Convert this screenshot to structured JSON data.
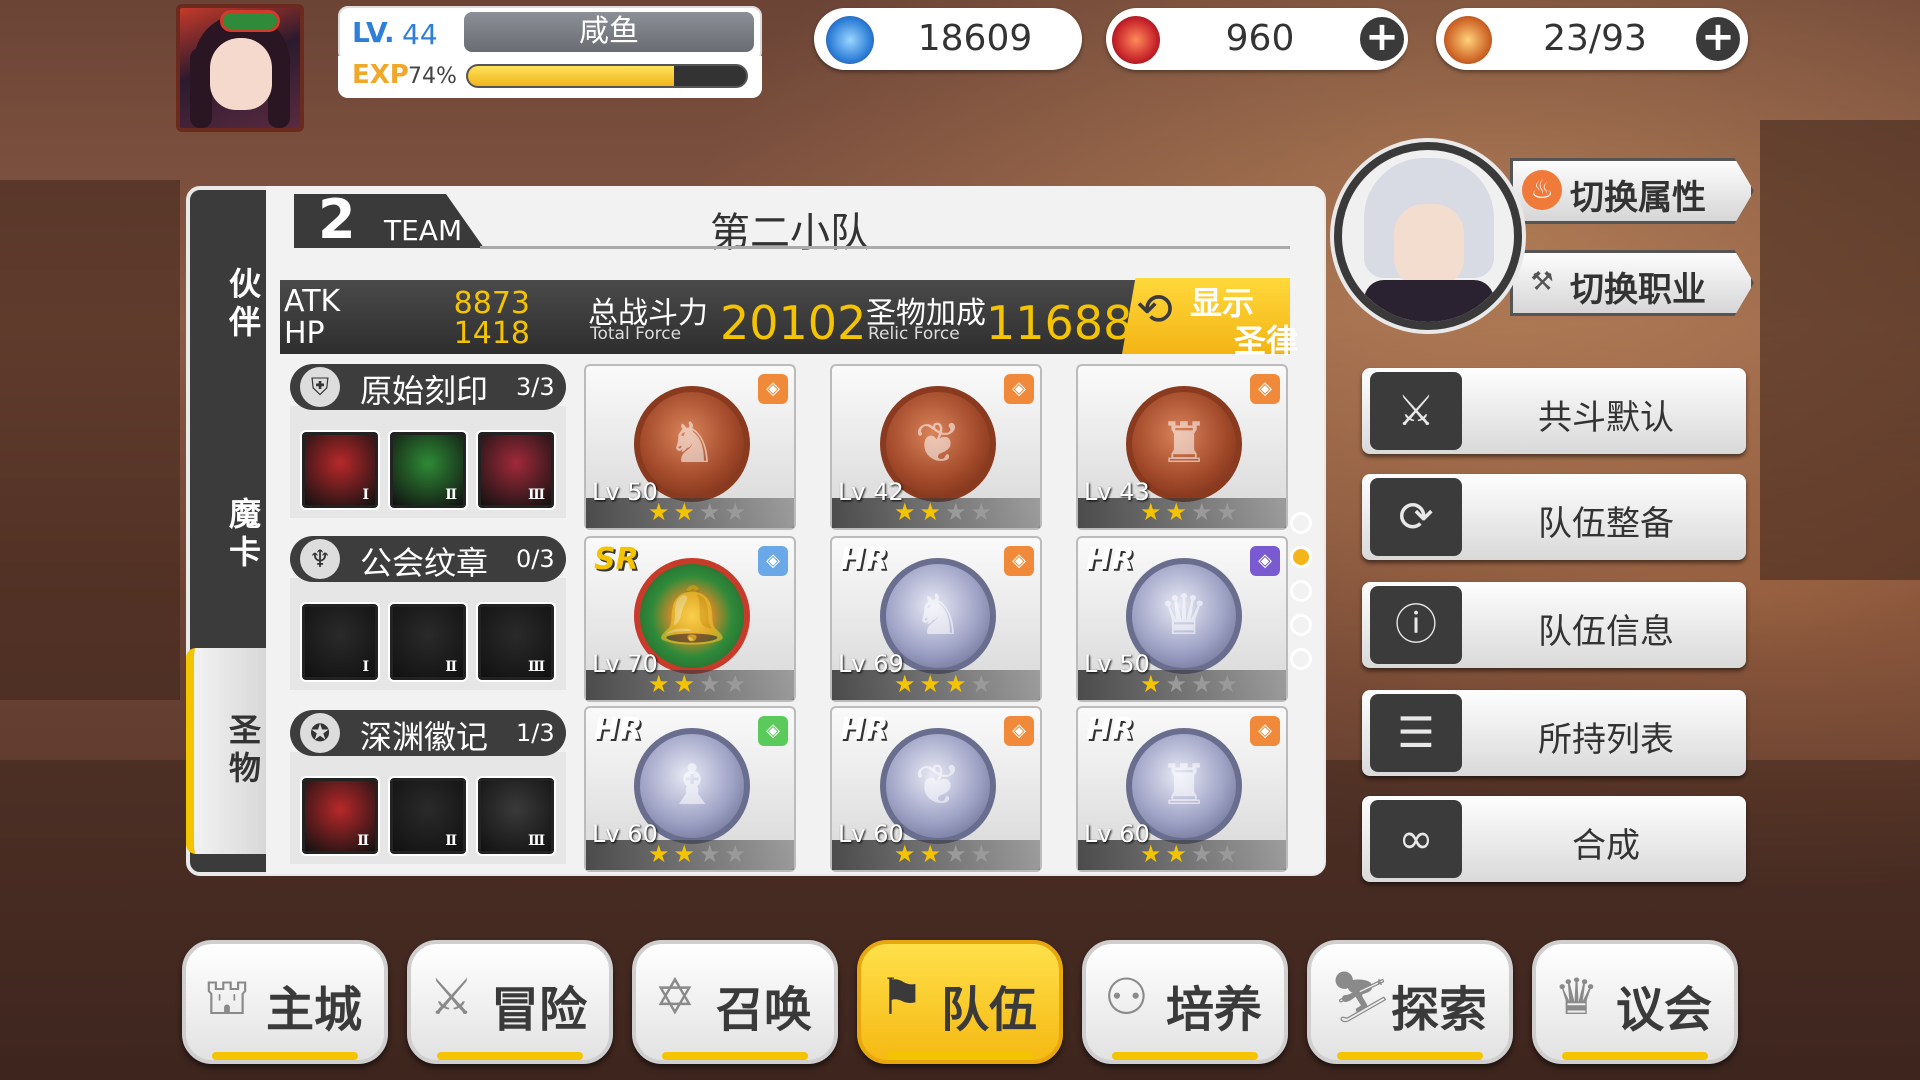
{
  "player": {
    "lv_label": "LV.",
    "level": "44",
    "name": "咸鱼",
    "exp_label": "EXP",
    "exp_percent_text": "74%",
    "exp_fraction": 0.74
  },
  "resources": [
    {
      "icon": "blue-flame-icon",
      "value": "18609",
      "has_plus": false
    },
    {
      "icon": "ruby-crystal-icon",
      "value": "960",
      "has_plus": true
    },
    {
      "icon": "hotdog-stamina-icon",
      "value": "23/93",
      "has_plus": true
    }
  ],
  "side_tabs": [
    {
      "label": "伙伴",
      "active": false
    },
    {
      "label": "魔卡",
      "active": false
    },
    {
      "label": "圣物",
      "active": true
    }
  ],
  "team": {
    "number": "2",
    "team_label": "TEAM",
    "title": "第二小队",
    "atk_label": "ATK",
    "atk_value": "8873",
    "hp_label": "HP",
    "hp_value": "1418",
    "total_force_label": "总战斗力",
    "total_force_sub": "Total Force",
    "total_force_value": "20102",
    "relic_force_label": "圣物加成",
    "relic_force_sub": "Relic Force",
    "relic_force_value": "11688",
    "law_button_line1": "显示",
    "law_button_line2": "圣律"
  },
  "groups": [
    {
      "name": "原始刻印",
      "count": "3/3",
      "icon": "shield-emblem-icon",
      "slots": [
        {
          "numeral": "Ⅰ",
          "color": "#b8282a"
        },
        {
          "numeral": "Ⅱ",
          "color": "#2e8a36"
        },
        {
          "numeral": "Ⅲ",
          "color": "#a02a3a"
        }
      ]
    },
    {
      "name": "公会纹章",
      "count": "0/3",
      "icon": "guild-crest-icon",
      "slots": [
        {
          "numeral": "Ⅰ",
          "color": "#2a2a2a"
        },
        {
          "numeral": "Ⅱ",
          "color": "#2a2a2a"
        },
        {
          "numeral": "Ⅲ",
          "color": "#2a2a2a"
        }
      ]
    },
    {
      "name": "深渊徽记",
      "count": "1/3",
      "icon": "abyss-sigil-icon",
      "slots": [
        {
          "numeral": "Ⅱ",
          "color": "#b8282a"
        },
        {
          "numeral": "Ⅱ",
          "color": "#2a2a2a"
        },
        {
          "numeral": "Ⅲ",
          "color": "#3a3a3a"
        }
      ]
    }
  ],
  "relic_cards": [
    {
      "rarity": "",
      "level": "Lv 50",
      "stars": 2,
      "medal": "bronze",
      "element": "fire",
      "symbol": "♞"
    },
    {
      "rarity": "",
      "level": "Lv 42",
      "stars": 2,
      "medal": "bronze",
      "element": "fire",
      "symbol": "❦"
    },
    {
      "rarity": "",
      "level": "Lv 43",
      "stars": 2,
      "medal": "bronze",
      "element": "fire",
      "symbol": "♜"
    },
    {
      "rarity": "SR",
      "level": "Lv 70",
      "stars": 2,
      "medal": "wreath",
      "element": "water",
      "symbol": "🔔"
    },
    {
      "rarity": "HR",
      "level": "Lv 69",
      "stars": 3,
      "medal": "silver",
      "element": "fire",
      "symbol": "♞"
    },
    {
      "rarity": "HR",
      "level": "Lv 50",
      "stars": 1,
      "medal": "silver",
      "element": "dark",
      "symbol": "♛"
    },
    {
      "rarity": "HR",
      "level": "Lv 60",
      "stars": 2,
      "medal": "silver",
      "element": "wind",
      "symbol": "♝"
    },
    {
      "rarity": "HR",
      "level": "Lv 60",
      "stars": 2,
      "medal": "silver",
      "element": "fire",
      "symbol": "❦"
    },
    {
      "rarity": "HR",
      "level": "Lv 60",
      "stars": 2,
      "medal": "silver",
      "element": "fire",
      "symbol": "♜"
    }
  ],
  "element_colors": {
    "fire": "#f08a3a",
    "water": "#6aa8e8",
    "dark": "#7a5ad0",
    "wind": "#5acb5a"
  },
  "page_dots": {
    "count": 5,
    "active_index": 1
  },
  "leader_buttons": [
    {
      "label": "切换属性",
      "icon": "flame-element-icon"
    },
    {
      "label": "切换职业",
      "icon": "crossed-tools-icon"
    }
  ],
  "menu": [
    {
      "label": "共斗默认",
      "icon": "crossed-swords-icon"
    },
    {
      "label": "队伍整备",
      "icon": "refresh-swirl-icon"
    },
    {
      "label": "队伍信息",
      "icon": "team-info-icon"
    },
    {
      "label": "所持列表",
      "icon": "list-window-icon"
    },
    {
      "label": "合成",
      "icon": "infinity-link-icon"
    }
  ],
  "nav": [
    {
      "label": "主城",
      "icon": "castle-icon",
      "active": false
    },
    {
      "label": "冒险",
      "icon": "crossed-swords-icon",
      "active": false
    },
    {
      "label": "召唤",
      "icon": "hexagram-icon",
      "active": false
    },
    {
      "label": "队伍",
      "icon": "team-flag-icon",
      "active": true
    },
    {
      "label": "培养",
      "icon": "triple-circle-icon",
      "active": false
    },
    {
      "label": "探索",
      "icon": "explorer-icon",
      "active": false
    },
    {
      "label": "议会",
      "icon": "dragon-crest-icon",
      "active": false
    }
  ]
}
